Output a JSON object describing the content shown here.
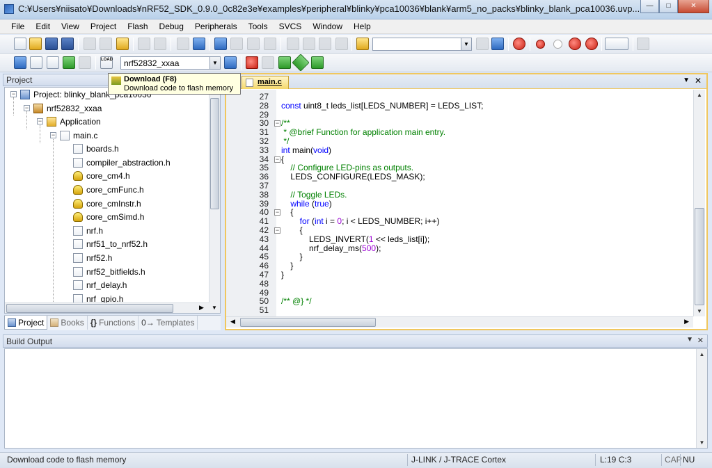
{
  "window": {
    "title": "C:¥Users¥niisato¥Downloads¥nRF52_SDK_0.9.0_0c82e3e¥examples¥peripheral¥blinky¥pca10036¥blank¥arm5_no_packs¥blinky_blank_pca10036.uvp...",
    "controls": {
      "minimize": "—",
      "maximize": "□",
      "close": "✕"
    }
  },
  "menu": [
    "File",
    "Edit",
    "View",
    "Project",
    "Flash",
    "Debug",
    "Peripherals",
    "Tools",
    "SVCS",
    "Window",
    "Help"
  ],
  "toolbar": {
    "find_combo_value": "",
    "target_combo_value": "nrf52832_xxaa",
    "load_icon_label": "LOAD"
  },
  "tooltip": {
    "title": "Download (F8)",
    "description": "Download code to flash memory"
  },
  "project_panel": {
    "header": "Project",
    "tree": [
      {
        "label": "Project: blinky_blank_pca10036",
        "icon": "project-icon",
        "expander": "−"
      },
      {
        "label": "nrf52832_xxaa",
        "icon": "target-icon",
        "expander": "−"
      },
      {
        "label": "Application",
        "icon": "folder-icon",
        "expander": "−"
      },
      {
        "label": "main.c",
        "icon": "file-icon",
        "expander": "−"
      },
      {
        "label": "boards.h",
        "icon": "file-icon"
      },
      {
        "label": "compiler_abstraction.h",
        "icon": "file-icon"
      },
      {
        "label": "core_cm4.h",
        "icon": "key-icon"
      },
      {
        "label": "core_cmFunc.h",
        "icon": "key-icon"
      },
      {
        "label": "core_cmInstr.h",
        "icon": "key-icon"
      },
      {
        "label": "core_cmSimd.h",
        "icon": "key-icon"
      },
      {
        "label": "nrf.h",
        "icon": "file-icon"
      },
      {
        "label": "nrf51_to_nrf52.h",
        "icon": "file-icon"
      },
      {
        "label": "nrf52.h",
        "icon": "file-icon"
      },
      {
        "label": "nrf52_bitfields.h",
        "icon": "file-icon"
      },
      {
        "label": "nrf_delay.h",
        "icon": "file-icon"
      },
      {
        "label": "nrf_gpio.h",
        "icon": "file-icon"
      }
    ],
    "tabs": [
      "Project",
      "Books",
      "Functions",
      "Templates"
    ],
    "tab_glyphs": [
      "",
      "",
      "{}",
      "0→"
    ]
  },
  "editor": {
    "active_tab": "main.c",
    "lines": [
      {
        "n": "27",
        "fold": "",
        "html": ""
      },
      {
        "n": "28",
        "fold": "",
        "html": "<span class=\"kw\">const</span> uint8_t leds_list[LEDS_NUMBER] = LEDS_LIST;"
      },
      {
        "n": "29",
        "fold": "",
        "html": ""
      },
      {
        "n": "30",
        "fold": "−",
        "html": "<span class=\"cm\">/**</span>"
      },
      {
        "n": "31",
        "fold": "",
        "html": "<span class=\"cm\"> * @brief Function for application main entry.</span>"
      },
      {
        "n": "32",
        "fold": "",
        "html": "<span class=\"cm\"> */</span>"
      },
      {
        "n": "33",
        "fold": "",
        "html": "<span class=\"kw\">int</span> main(<span class=\"kw\">void</span>)"
      },
      {
        "n": "34",
        "fold": "−",
        "html": "{"
      },
      {
        "n": "35",
        "fold": "",
        "html": "    <span class=\"cm\">// Configure LED-pins as outputs.</span>"
      },
      {
        "n": "36",
        "fold": "",
        "html": "    LEDS_CONFIGURE(LEDS_MASK);"
      },
      {
        "n": "37",
        "fold": "",
        "html": ""
      },
      {
        "n": "38",
        "fold": "",
        "html": "    <span class=\"cm\">// Toggle LEDs.</span>"
      },
      {
        "n": "39",
        "fold": "",
        "html": "    <span class=\"kw\">while</span> (<span class=\"kw\">true</span>)"
      },
      {
        "n": "40",
        "fold": "−",
        "html": "    {"
      },
      {
        "n": "41",
        "fold": "",
        "html": "        <span class=\"kw\">for</span> (<span class=\"kw\">int</span> i = <span class=\"num\">0</span>; i &lt; LEDS_NUMBER; i++)"
      },
      {
        "n": "42",
        "fold": "−",
        "html": "        {"
      },
      {
        "n": "43",
        "fold": "",
        "html": "            LEDS_INVERT(<span class=\"num\">1</span> &lt;&lt; leds_list[i]);"
      },
      {
        "n": "44",
        "fold": "",
        "html": "            nrf_delay_ms(<span class=\"num\">500</span>);"
      },
      {
        "n": "45",
        "fold": "",
        "html": "        }"
      },
      {
        "n": "46",
        "fold": "",
        "html": "    }"
      },
      {
        "n": "47",
        "fold": "",
        "html": "}"
      },
      {
        "n": "48",
        "fold": "",
        "html": ""
      },
      {
        "n": "49",
        "fold": "",
        "html": ""
      },
      {
        "n": "50",
        "fold": "",
        "html": "<span class=\"cm\">/** @} */</span>"
      },
      {
        "n": "51",
        "fold": "",
        "html": ""
      }
    ]
  },
  "build_output": {
    "header": "Build Output",
    "content": ""
  },
  "statusbar": {
    "message": "Download code to flash memory",
    "debugger": "J-LINK / J-TRACE Cortex",
    "position": "L:19 C:3",
    "caps": "CAP",
    "num": "NU"
  }
}
